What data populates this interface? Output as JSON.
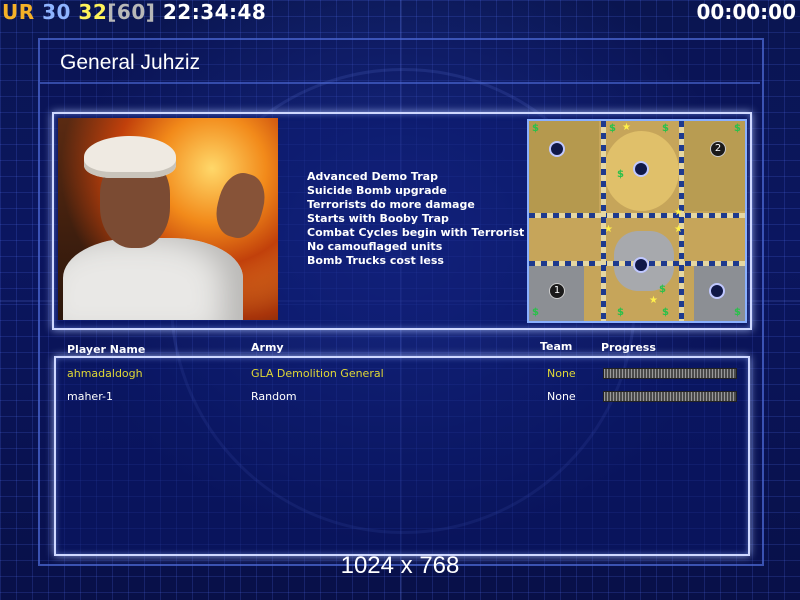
{
  "hud": {
    "prefix": "UR",
    "value_a": "30",
    "value_b": "32",
    "bracket_value": "[60]",
    "clock": "22:34:48",
    "timer": "00:00:00"
  },
  "general": {
    "title": "General Juhziz",
    "perks": [
      "Advanced Demo Trap",
      "Suicide Bomb upgrade",
      "Terrorists do more damage",
      "Starts with Booby Trap",
      "Combat Cycles begin with Terrorist",
      "No camouflaged units",
      "Bomb Trucks cost less"
    ]
  },
  "minimap": {
    "player_markers": [
      "1",
      "2"
    ],
    "money_icon": "$",
    "star_icon": "★"
  },
  "players": {
    "headers": {
      "name": "Player Name",
      "army": "Army",
      "team": "Team",
      "progress": "Progress"
    },
    "rows": [
      {
        "name": "ahmadaldogh",
        "army": "GLA Demolition General",
        "team": "None",
        "progress": 1.0
      },
      {
        "name": "maher-1",
        "army": "Random",
        "team": "None",
        "progress": 1.0
      }
    ]
  },
  "footer": {
    "resolution": "1024 x 768"
  },
  "colors": {
    "local_player": "#e0d836",
    "hud_orange": "#f6b127",
    "hud_blue": "#8fb4ff",
    "hud_yellow": "#fff35a"
  }
}
